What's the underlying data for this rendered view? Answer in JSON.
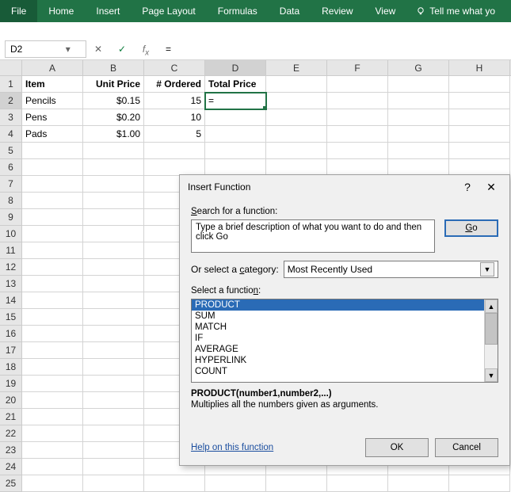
{
  "ribbon": {
    "tabs": [
      "File",
      "Home",
      "Insert",
      "Page Layout",
      "Formulas",
      "Data",
      "Review",
      "View"
    ],
    "tellme": "Tell me what yo"
  },
  "namebox": "D2",
  "formula": "=",
  "columns": [
    "A",
    "B",
    "C",
    "D",
    "E",
    "F",
    "G",
    "H"
  ],
  "grid": {
    "headers": {
      "item": "Item",
      "unitprice": "Unit Price",
      "ordered": "# Ordered",
      "total": "Total Price"
    },
    "rows": [
      {
        "item": "Pencils",
        "price": "$0.15",
        "qty": "15",
        "total": "="
      },
      {
        "item": "Pens",
        "price": "$0.20",
        "qty": "10",
        "total": ""
      },
      {
        "item": "Pads",
        "price": "$1.00",
        "qty": "5",
        "total": ""
      }
    ]
  },
  "dialog": {
    "title": "Insert Function",
    "search_label": "Search for a function:",
    "search_text": "Type a brief description of what you want to do and then click Go",
    "go": "Go",
    "cat_label": "Or select a category:",
    "cat_value": "Most Recently Used",
    "select_label": "Select a function:",
    "functions": [
      "PRODUCT",
      "SUM",
      "MATCH",
      "IF",
      "AVERAGE",
      "HYPERLINK",
      "COUNT"
    ],
    "signature": "PRODUCT(number1,number2,...)",
    "description": "Multiplies all the numbers given as arguments.",
    "help": "Help on this function",
    "ok": "OK",
    "cancel": "Cancel"
  }
}
